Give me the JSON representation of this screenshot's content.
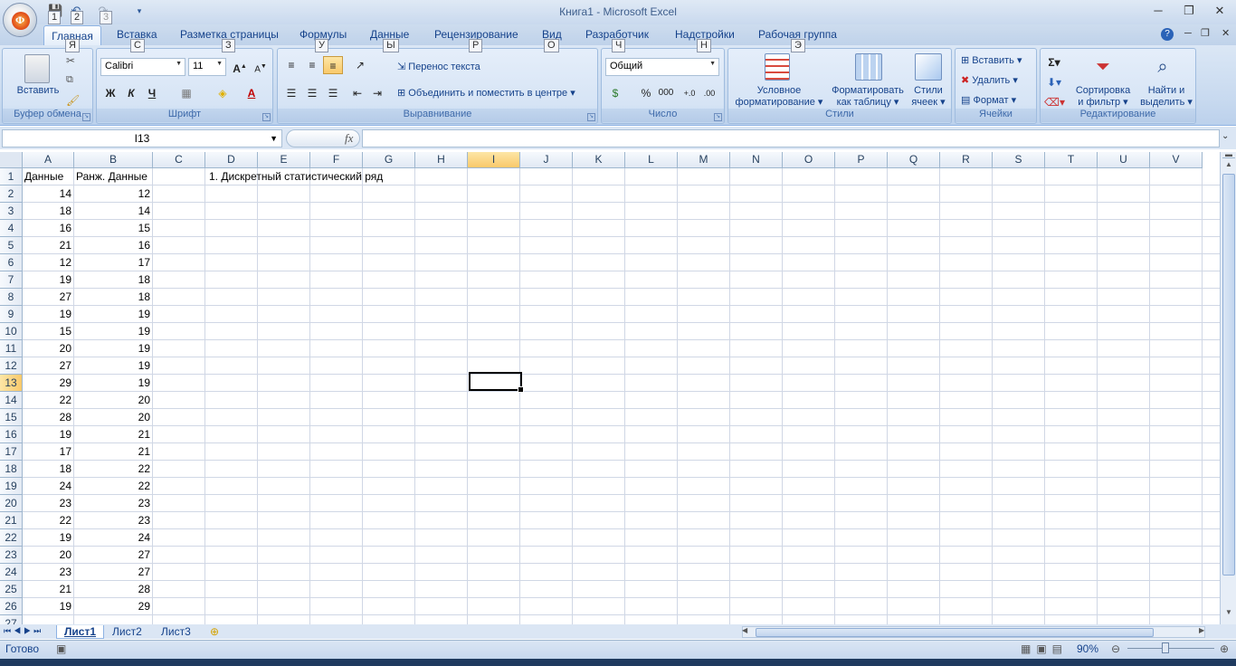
{
  "window": {
    "title": "Книга1 - Microsoft Excel",
    "qat_keytips": [
      "1",
      "2",
      "3"
    ],
    "controls": [
      "─",
      "❐",
      "✕"
    ]
  },
  "tabs": [
    {
      "label": "Главная",
      "keytip": "Я",
      "active": true
    },
    {
      "label": "Вставка",
      "keytip": "С"
    },
    {
      "label": "Разметка страницы",
      "keytip": "З"
    },
    {
      "label": "Формулы",
      "keytip": "У"
    },
    {
      "label": "Данные",
      "keytip": "Ы"
    },
    {
      "label": "Рецензирование",
      "keytip": "Р"
    },
    {
      "label": "Вид",
      "keytip": "О"
    },
    {
      "label": "Разработчик",
      "keytip": "Ч"
    },
    {
      "label": "Надстройки",
      "keytip": "Н"
    },
    {
      "label": "Рабочая группа",
      "keytip": "Э"
    }
  ],
  "ribbon": {
    "clipboard": {
      "label": "Буфер обмена",
      "paste": "Вставить"
    },
    "font": {
      "label": "Шрифт",
      "font_name": "Calibri",
      "font_size": "11",
      "bold": "Ж",
      "italic": "К",
      "underline": "Ч"
    },
    "alignment": {
      "label": "Выравнивание",
      "wrap": "Перенос текста",
      "merge": "Объединить и поместить в центре"
    },
    "number": {
      "label": "Число",
      "format": "Общий",
      "percent": "%",
      "thousands": "000"
    },
    "styles": {
      "label": "Стили",
      "conditional": [
        "Условное",
        "форматирование"
      ],
      "table": [
        "Форматировать",
        "как таблицу"
      ],
      "cell_styles": [
        "Стили",
        "ячеек"
      ]
    },
    "cells": {
      "label": "Ячейки",
      "insert": "Вставить",
      "delete": "Удалить",
      "format": "Формат"
    },
    "editing": {
      "label": "Редактирование",
      "sort": [
        "Сортировка",
        "и фильтр"
      ],
      "find": [
        "Найти и",
        "выделить"
      ]
    }
  },
  "formula_bar": {
    "name_box": "I13",
    "fx": "fx",
    "value": ""
  },
  "columns": [
    "A",
    "B",
    "C",
    "D",
    "E",
    "F",
    "G",
    "H",
    "I",
    "J",
    "K",
    "L",
    "M",
    "N",
    "O",
    "P",
    "Q",
    "R",
    "S",
    "T",
    "U",
    "V"
  ],
  "rows": [
    "1",
    "2",
    "3",
    "4",
    "5",
    "6",
    "7",
    "8",
    "9",
    "10",
    "11",
    "12",
    "13",
    "14",
    "15",
    "16",
    "17",
    "18",
    "19",
    "20",
    "21",
    "22",
    "23",
    "24",
    "25",
    "26",
    "27"
  ],
  "selected": {
    "column": "I",
    "row": "13"
  },
  "sheet": {
    "header_a": "Данные",
    "header_b": "Ранж. Данные",
    "d1": "1. Дискретный статистический ряд",
    "col_a": [
      "14",
      "18",
      "16",
      "21",
      "12",
      "19",
      "27",
      "19",
      "15",
      "20",
      "27",
      "29",
      "22",
      "28",
      "19",
      "17",
      "18",
      "24",
      "23",
      "22",
      "19",
      "20",
      "23",
      "21",
      "19"
    ],
    "col_b": [
      "12",
      "14",
      "15",
      "16",
      "17",
      "18",
      "18",
      "19",
      "19",
      "19",
      "19",
      "19",
      "20",
      "20",
      "21",
      "21",
      "22",
      "22",
      "23",
      "23",
      "24",
      "27",
      "27",
      "28",
      "29"
    ]
  },
  "sheet_tabs": [
    "Лист1",
    "Лист2",
    "Лист3"
  ],
  "status": {
    "ready": "Готово",
    "zoom": "90%"
  }
}
